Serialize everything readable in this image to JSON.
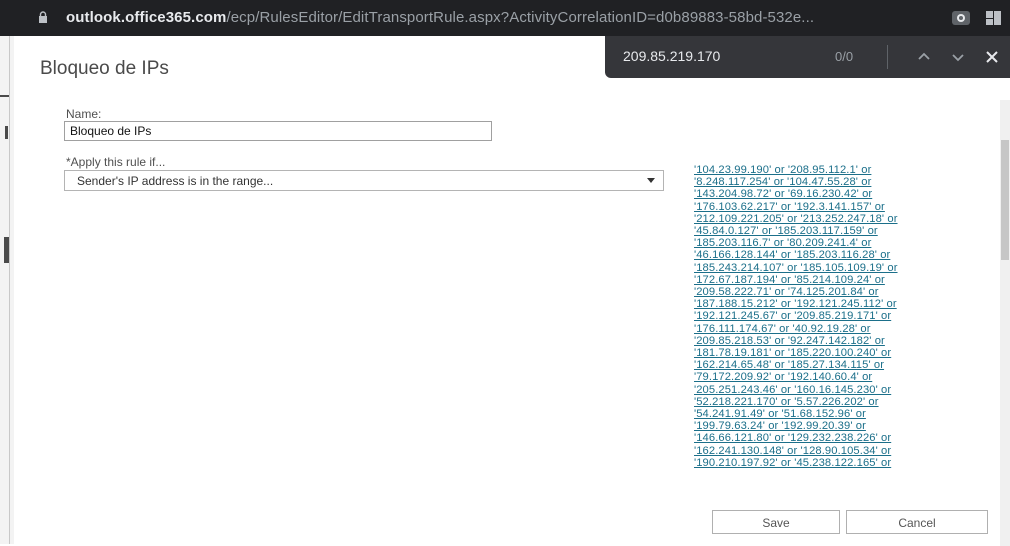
{
  "browser": {
    "url_host": "outlook.office365.com",
    "url_path": "/ecp/RulesEditor/EditTransportRule.aspx?ActivityCorrelationID=d0b89883-58bd-532e...",
    "icons": [
      "lock-icon",
      "screen-capture-icon",
      "extensions-icon"
    ]
  },
  "find_bar": {
    "query": "209.85.219.170",
    "count": "0/0",
    "icons": [
      "chevron-up-icon",
      "chevron-down-icon",
      "close-icon"
    ]
  },
  "dialog": {
    "title": "Bloqueo de IPs",
    "name_label": "Name:",
    "name_value": "Bloqueo de IPs",
    "condition_label": "*Apply this rule if...",
    "condition_value": "Sender's IP address is in the range...",
    "ip_list": [
      "'104.23.99.190' or '208.95.112.1' or",
      "'8.248.117.254' or '104.47.55.28' or",
      "'143.204.98.72' or '69.16.230.42' or",
      "'176.103.62.217' or '192.3.141.157' or",
      "'212.109.221.205' or '213.252.247.18' or",
      "'45.84.0.127' or '185.203.117.159' or",
      "'185.203.116.7' or '80.209.241.4' or",
      "'46.166.128.144' or '185.203.116.28' or",
      "'185.243.214.107' or '185.105.109.19' or",
      "'172.67.187.194' or '85.214.109.24' or",
      "'209.58.222.71' or '74.125.201.84' or",
      "'187.188.15.212' or '192.121.245.112' or",
      "'192.121.245.67' or '209.85.219.171' or",
      "'176.111.174.67' or '40.92.19.28' or",
      "'209.85.218.53' or '92.247.142.182' or",
      "'181.78.19.181' or '185.220.100.240' or",
      "'162.214.65.48' or '185.27.134.115' or",
      "'79.172.209.92' or '192.140.60.4' or",
      "'205.251.243.46' or '160.16.145.230' or",
      "'52.218.221.170' or '5.57.226.202' or",
      "'54.241.91.49' or '51.68.152.96' or",
      "'199.79.63.24' or '192.99.20.39' or",
      "'146.66.121.80' or '129.232.238.226' or",
      "'162.241.130.148' or '128.90.105.34' or",
      "'190.210.197.92' or '45.238.122.165' or"
    ],
    "save_label": "Save",
    "cancel_label": "Cancel"
  },
  "colors": {
    "link": "#1b6f8a",
    "browser_bar": "#202124",
    "find_bar": "#35363a"
  }
}
